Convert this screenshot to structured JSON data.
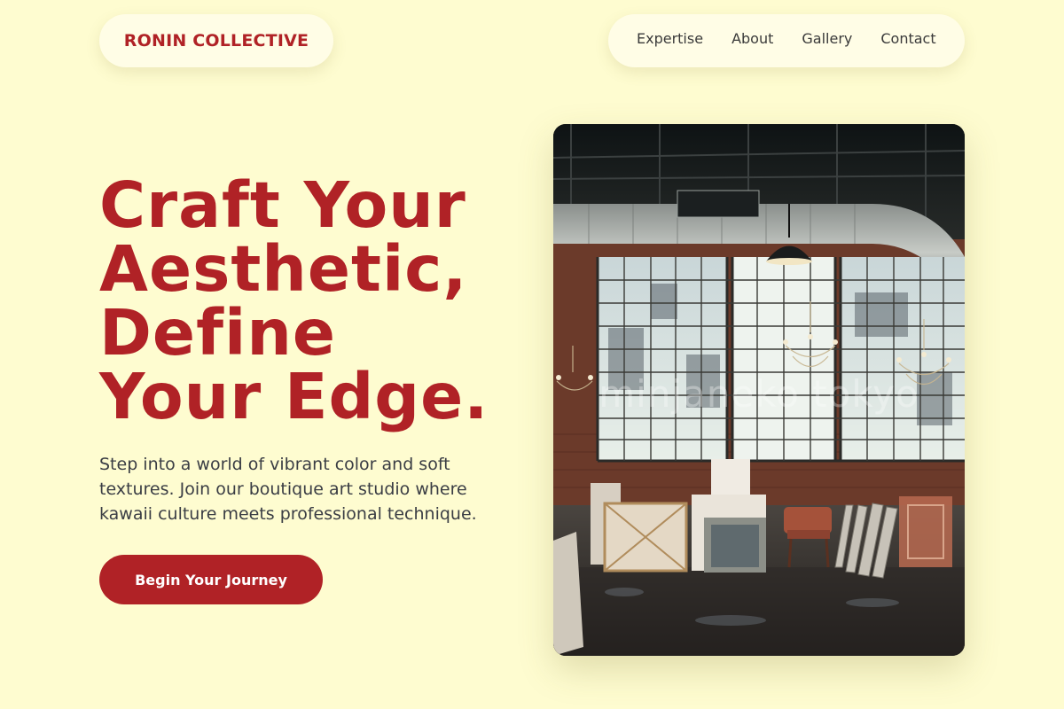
{
  "brand": {
    "name": "RONIN COLLECTIVE"
  },
  "nav": {
    "items": [
      {
        "label": "Expertise"
      },
      {
        "label": "About"
      },
      {
        "label": "Gallery"
      },
      {
        "label": "Contact"
      }
    ]
  },
  "hero": {
    "headline_lines": [
      "Craft Your",
      "Aesthetic,",
      "Define",
      "Your Edge."
    ],
    "subtext": "Step into a world of vibrant color and soft textures. Join our boutique art studio where kawaii culture meets professional technique.",
    "cta_label": "Begin Your Journey",
    "image": {
      "subject": "industrial loft art studio with chandeliers and canvases",
      "watermark": "minjaneko tokyo"
    }
  },
  "colors": {
    "background": "#fefcd0",
    "accent": "#b02226",
    "pill": "#fffde6",
    "body_text": "#3a3d44"
  }
}
